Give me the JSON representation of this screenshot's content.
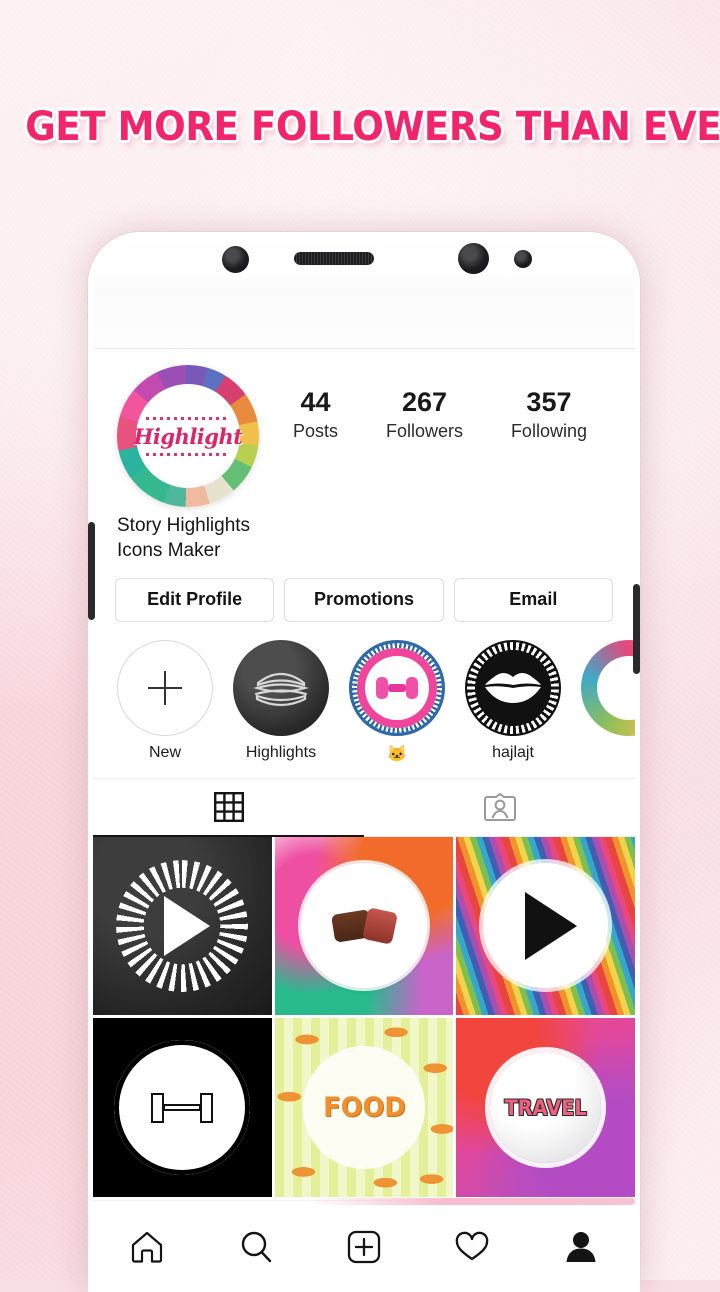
{
  "headline": "GET MORE FOLLOWERS THAN EVER!",
  "colors": {
    "headline_pink": "#f2246b",
    "background_pink": "#f9dfe3",
    "phone_body": "#ffffff",
    "active_tab": "#141414",
    "food_orange": "#ef8f2e",
    "travel_pink": "#ef5f7e"
  },
  "phone": {
    "bezel": {
      "camera_left": "camera-icon",
      "speaker": "speaker-grille-icon",
      "camera_right": "camera-icon",
      "sensor": "proximity-sensor-icon"
    },
    "buttons": {
      "volume": "volume-button",
      "power": "power-button"
    }
  },
  "profile": {
    "avatar": {
      "script_text": "Highlight",
      "alt": "story-highlights-logo"
    },
    "stats": [
      {
        "number": "44",
        "label": "Posts"
      },
      {
        "number": "267",
        "label": "Followers"
      },
      {
        "number": "357",
        "label": "Following"
      }
    ],
    "bio_line1": "Story Highlights",
    "bio_line2": "Icons Maker",
    "actions": [
      {
        "label": "Edit Profile"
      },
      {
        "label": "Promotions"
      },
      {
        "label": "Email"
      }
    ]
  },
  "highlights": [
    {
      "label": "New",
      "icon": "plus-icon"
    },
    {
      "label": "Highlights",
      "icon": "burger-sketch-icon"
    },
    {
      "label": "🐱",
      "icon": "pink-dumbbell-icon"
    },
    {
      "label": "hajlajt",
      "icon": "lips-icon"
    },
    {
      "label": "",
      "icon": "colorful-ring-icon"
    }
  ],
  "tabs": [
    {
      "name": "grid",
      "icon": "grid-icon",
      "active": true
    },
    {
      "name": "tagged",
      "icon": "tagged-icon",
      "active": false
    }
  ],
  "grid_posts": [
    {
      "name": "chalkboard-play-post",
      "caption": ""
    },
    {
      "name": "watercolor-steak-post",
      "caption": ""
    },
    {
      "name": "striped-play-post",
      "caption": ""
    },
    {
      "name": "gym-dumbbell-post",
      "caption": ""
    },
    {
      "name": "food-hotdog-post",
      "caption": "FOOD"
    },
    {
      "name": "travel-gradient-post",
      "caption": "TRAVEL"
    }
  ],
  "bottom_nav": [
    {
      "name": "home",
      "icon": "home-icon",
      "active": false
    },
    {
      "name": "search",
      "icon": "search-icon",
      "active": false
    },
    {
      "name": "add",
      "icon": "plus-box-icon",
      "active": false
    },
    {
      "name": "activity",
      "icon": "heart-icon",
      "active": false
    },
    {
      "name": "profile",
      "icon": "person-icon",
      "active": true
    }
  ]
}
